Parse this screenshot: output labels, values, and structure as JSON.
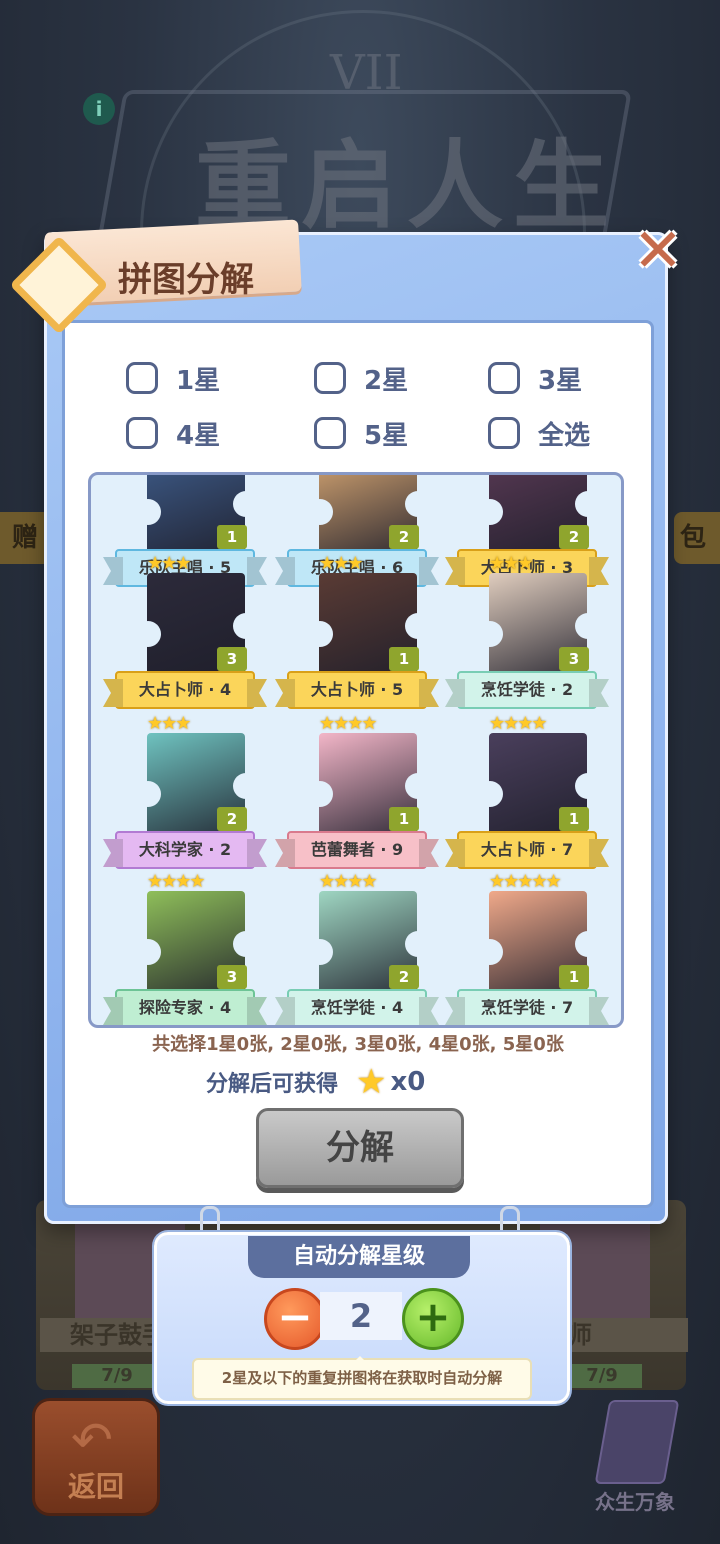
{
  "background": {
    "title": "重启人生",
    "numeral": "VII",
    "info_badge": "i",
    "side_left": "赠",
    "side_right": "包",
    "shelf_left_label": "架子鼓手",
    "shelf_right_label": "师",
    "shelf_left_count": "7/9",
    "shelf_right_count": "7/9",
    "back_label": "返回",
    "codex_label": "众生万象"
  },
  "dialog": {
    "title": "拼图分解",
    "close_icon": "close-icon",
    "filters": [
      {
        "label": "1星",
        "checked": false
      },
      {
        "label": "2星",
        "checked": false
      },
      {
        "label": "3星",
        "checked": false
      },
      {
        "label": "4星",
        "checked": false
      },
      {
        "label": "5星",
        "checked": false
      },
      {
        "label": "全选",
        "checked": false
      }
    ],
    "pieces": [
      {
        "name": "乐队主唱 · 5",
        "qty": "1",
        "stars": "",
        "ribbon": "blue",
        "art": "#3e5c8a"
      },
      {
        "name": "乐队主唱 · 6",
        "qty": "2",
        "stars": "",
        "ribbon": "blue",
        "art": "#d9a874"
      },
      {
        "name": "大占卜师 · 3",
        "qty": "2",
        "stars": "",
        "ribbon": "gold",
        "art": "#5a3a55"
      },
      {
        "name": "大占卜师 · 4",
        "qty": "3",
        "stars": "★★★",
        "ribbon": "gold",
        "art": "#2c2a3a"
      },
      {
        "name": "大占卜师 · 5",
        "qty": "1",
        "stars": "★★★",
        "ribbon": "gold",
        "art": "#5a3b34"
      },
      {
        "name": "烹饪学徒 · 2",
        "qty": "3",
        "stars": "★★★",
        "ribbon": "mint",
        "art": "#e0cdbe"
      },
      {
        "name": "大科学家 · 2",
        "qty": "2",
        "stars": "★★★",
        "ribbon": "violet",
        "art": "#6fc3c0"
      },
      {
        "name": "芭蕾舞者 · 9",
        "qty": "1",
        "stars": "★★★★",
        "ribbon": "pink",
        "art": "#f3b6c8"
      },
      {
        "name": "大占卜师 · 7",
        "qty": "1",
        "stars": "★★★★",
        "ribbon": "gold",
        "art": "#4a3f5c"
      },
      {
        "name": "探险专家 · 4",
        "qty": "3",
        "stars": "★★★★",
        "ribbon": "green",
        "art": "#8fbf5a"
      },
      {
        "name": "烹饪学徒 · 4",
        "qty": "2",
        "stars": "★★★★",
        "ribbon": "mint",
        "art": "#9fd6c2"
      },
      {
        "name": "烹饪学徒 · 7",
        "qty": "1",
        "stars": "★★★★★",
        "ribbon": "mint",
        "art": "#f0a98a"
      }
    ],
    "summary": "共选择1星0张, 2星0张, 3星0张, 4星0张, 5星0张",
    "reward_label": "分解后可获得",
    "reward_icon": "star-icon",
    "reward_count": "x0",
    "decompose_label": "分解"
  },
  "auto_decompose": {
    "title": "自动分解星级",
    "level": "2",
    "minus_label": "−",
    "plus_label": "+",
    "tip": "2星及以下的重复拼图将在获取时自动分解"
  },
  "colors": {
    "dialog_blue": "#8fb4ee",
    "text_navy": "#536289",
    "star_gold": "#ffc928",
    "button_gray": "#b4b4b4",
    "minus_orange": "#e5582a",
    "plus_green": "#66b92a"
  }
}
